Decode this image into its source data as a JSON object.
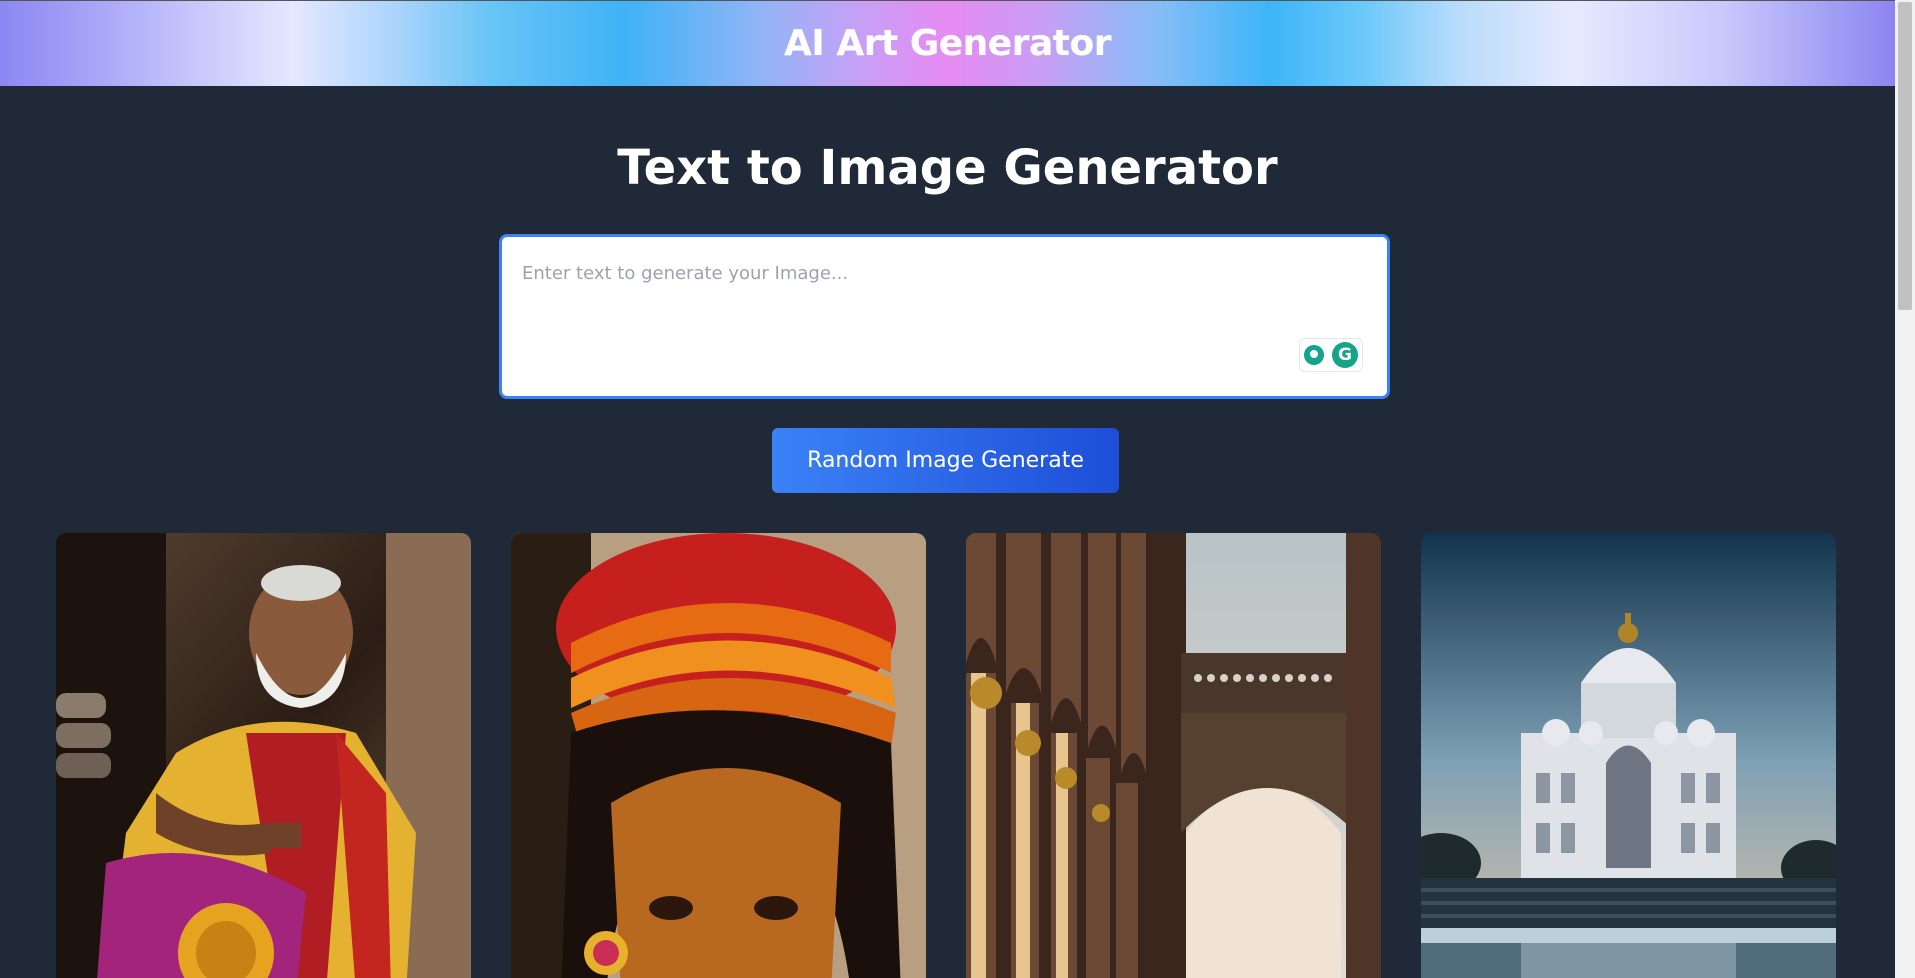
{
  "header": {
    "app_title": "AI Art Generator"
  },
  "main": {
    "heading": "Text to Image Generator",
    "prompt": {
      "value": "",
      "placeholder": "Enter text to generate your Image..."
    },
    "extension_widget": {
      "icons": [
        "lightbulb-icon",
        "grammarly-icon"
      ],
      "badge_letter": "G"
    },
    "generate_button_label": "Random Image Generate"
  },
  "gallery": {
    "images": [
      {
        "subject": "elderly-man-with-instrument"
      },
      {
        "subject": "woman-in-turban"
      },
      {
        "subject": "arched-corridor"
      },
      {
        "subject": "domed-palace"
      }
    ]
  },
  "colors": {
    "background": "#1f2937",
    "accent": "#3b82f6",
    "button_end": "#1d4ed8",
    "header_pink": "#e68bf2",
    "header_blue": "#3fb2f6"
  }
}
